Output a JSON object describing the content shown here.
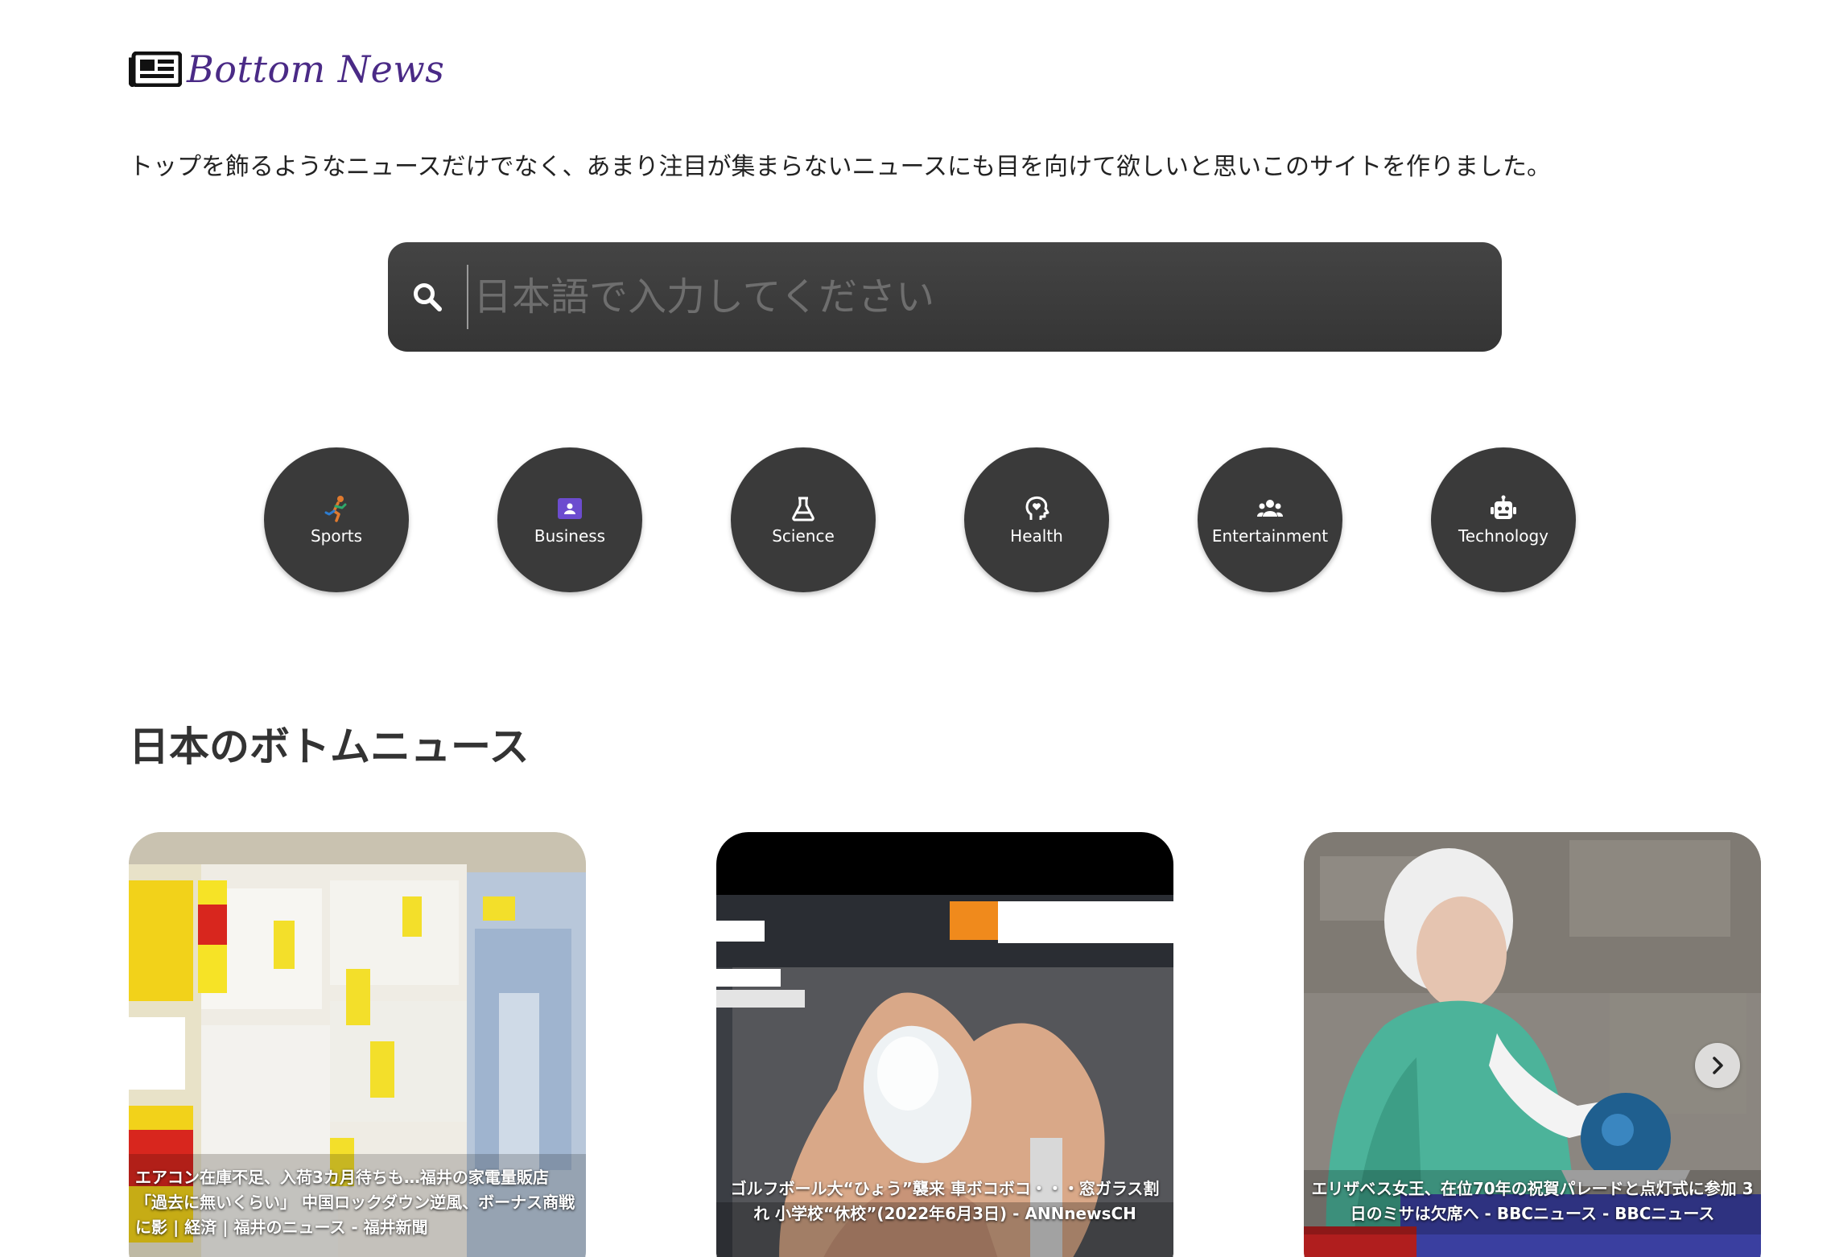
{
  "header": {
    "logo_text": "Bottom News",
    "logo_icon": "newspaper-icon",
    "tagline": "トップを飾るようなニュースだけでなく、あまり注目が集まらないニュースにも目を向けて欲しいと思いこのサイトを作りました。"
  },
  "search": {
    "placeholder": "日本語で入力してください",
    "icon": "search-icon"
  },
  "categories": [
    {
      "label": "Sports",
      "icon": "running-person-icon"
    },
    {
      "label": "Business",
      "icon": "business-badge-icon"
    },
    {
      "label": "Science",
      "icon": "flask-icon"
    },
    {
      "label": "Health",
      "icon": "head-heart-icon"
    },
    {
      "label": "Entertainment",
      "icon": "group-icon"
    },
    {
      "label": "Technology",
      "icon": "robot-icon"
    }
  ],
  "section": {
    "title": "日本のボトムニュース"
  },
  "news": [
    {
      "caption": "エアコン在庫不足、入荷3カ月待ちも…福井の家電量販店「過去に無いくらい」 中国ロックダウン逆風、ボーナス商戦に影 | 経済 | 福井のニュース - 福井新聞",
      "image": "air-conditioner-store-photo"
    },
    {
      "caption": "ゴルフボール大“ひょう”襲来 車ボコボコ・・・窓ガラス割れ 小学校“休校”(2022年6月3日) - ANNnewsCH",
      "image": "hailstone-in-hand-photo"
    },
    {
      "caption": "エリザベス女王、在位70年の祝賀パレードと点灯式に参加 3日のミサは欠席へ - BBCニュース - BBCニュース",
      "image": "queen-elizabeth-photo"
    }
  ],
  "carousel": {
    "next_icon": "chevron-right-icon"
  },
  "colors": {
    "logo": "#4a2a86",
    "search_bg": "#3c3c3c",
    "category_bg": "#3a3a3a",
    "sports_icon": "#e07a2e",
    "business_icon": "#6c4ccf"
  }
}
